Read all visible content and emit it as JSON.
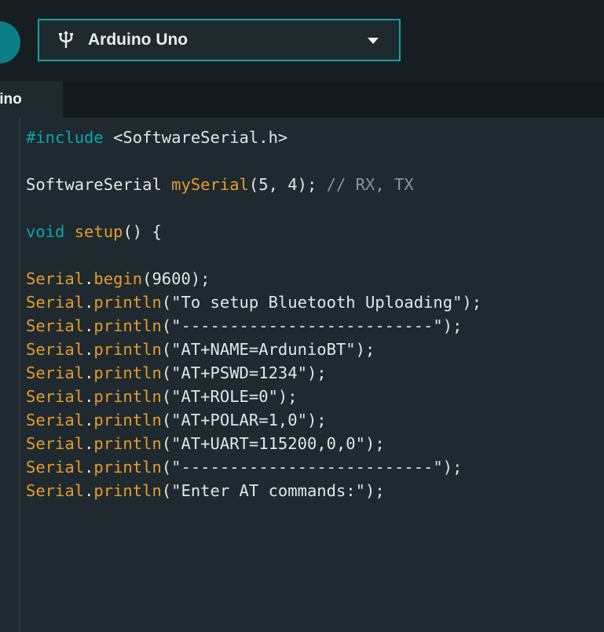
{
  "toolbar": {
    "board_label": "Arduino Uno",
    "board_icon": "usb-icon",
    "dropdown_icon": "chevron-down-icon"
  },
  "tab": {
    "label": ".ino"
  },
  "code": {
    "lines": [
      [
        {
          "t": "#include ",
          "c": "kw"
        },
        {
          "t": "<SoftwareSerial.h>",
          "c": "pl"
        }
      ],
      [],
      [
        {
          "t": "SoftwareSerial ",
          "c": "pl"
        },
        {
          "t": "mySerial",
          "c": "fn"
        },
        {
          "t": "(5, 4); ",
          "c": "pl"
        },
        {
          "t": "// RX, TX",
          "c": "cmt"
        }
      ],
      [],
      [
        {
          "t": "void ",
          "c": "kw"
        },
        {
          "t": "setup",
          "c": "fn"
        },
        {
          "t": "() {",
          "c": "pl"
        }
      ],
      [],
      [
        {
          "t": "Serial",
          "c": "fn"
        },
        {
          "t": ".",
          "c": "pl"
        },
        {
          "t": "begin",
          "c": "fn"
        },
        {
          "t": "(9600);",
          "c": "pl"
        }
      ],
      [
        {
          "t": "Serial",
          "c": "fn"
        },
        {
          "t": ".",
          "c": "pl"
        },
        {
          "t": "println",
          "c": "fn"
        },
        {
          "t": "(\"To setup Bluetooth Uploading\");",
          "c": "pl"
        }
      ],
      [
        {
          "t": "Serial",
          "c": "fn"
        },
        {
          "t": ".",
          "c": "pl"
        },
        {
          "t": "println",
          "c": "fn"
        },
        {
          "t": "(\"--------------------------\");",
          "c": "pl"
        }
      ],
      [
        {
          "t": "Serial",
          "c": "fn"
        },
        {
          "t": ".",
          "c": "pl"
        },
        {
          "t": "println",
          "c": "fn"
        },
        {
          "t": "(\"AT+NAME=ArdunioBT\");",
          "c": "pl"
        }
      ],
      [
        {
          "t": "Serial",
          "c": "fn"
        },
        {
          "t": ".",
          "c": "pl"
        },
        {
          "t": "println",
          "c": "fn"
        },
        {
          "t": "(\"AT+PSWD=1234\");",
          "c": "pl"
        }
      ],
      [
        {
          "t": "Serial",
          "c": "fn"
        },
        {
          "t": ".",
          "c": "pl"
        },
        {
          "t": "println",
          "c": "fn"
        },
        {
          "t": "(\"AT+ROLE=0\");",
          "c": "pl"
        }
      ],
      [
        {
          "t": "Serial",
          "c": "fn"
        },
        {
          "t": ".",
          "c": "pl"
        },
        {
          "t": "println",
          "c": "fn"
        },
        {
          "t": "(\"AT+POLAR=1,0\");",
          "c": "pl"
        }
      ],
      [
        {
          "t": "Serial",
          "c": "fn"
        },
        {
          "t": ".",
          "c": "pl"
        },
        {
          "t": "println",
          "c": "fn"
        },
        {
          "t": "(\"AT+UART=115200,0,0\");",
          "c": "pl"
        }
      ],
      [
        {
          "t": "Serial",
          "c": "fn"
        },
        {
          "t": ".",
          "c": "pl"
        },
        {
          "t": "println",
          "c": "fn"
        },
        {
          "t": "(\"--------------------------\");",
          "c": "pl"
        }
      ],
      [
        {
          "t": "Serial",
          "c": "fn"
        },
        {
          "t": ".",
          "c": "pl"
        },
        {
          "t": "println",
          "c": "fn"
        },
        {
          "t": "(\"Enter AT commands:\");",
          "c": "pl"
        }
      ]
    ]
  },
  "colors": {
    "accent": "#0fa3a6",
    "keyword": "#0aa6b0",
    "function": "#e89a2c",
    "comment": "#8a969b"
  }
}
